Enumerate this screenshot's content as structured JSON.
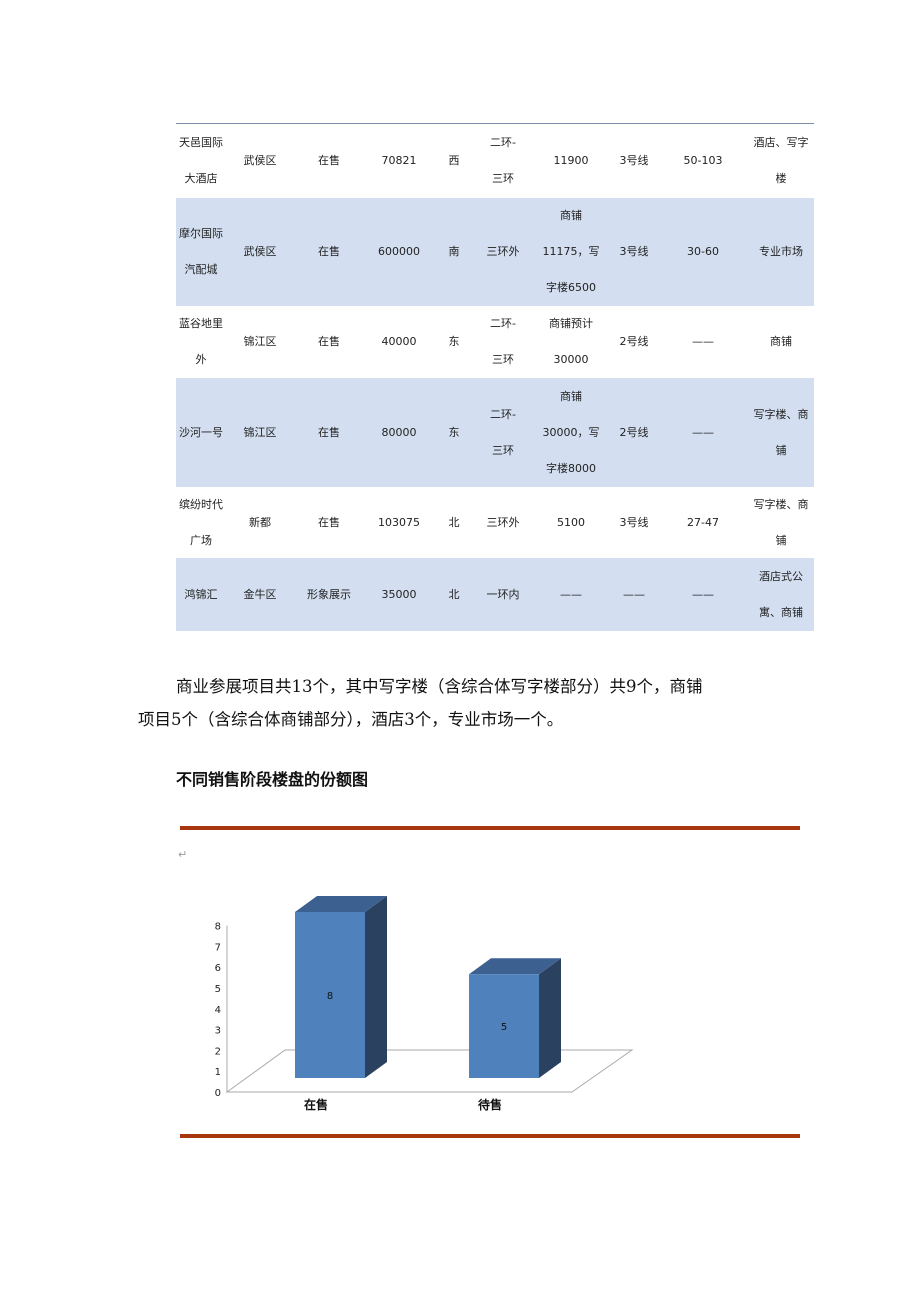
{
  "table": {
    "rows": [
      {
        "cells": [
          "天邑国际\n大酒店",
          "武侯区",
          "在售",
          "70821",
          "西",
          "二环-\n三环",
          "11900",
          "3号线",
          "50-103",
          "酒店、写字\n楼"
        ],
        "height": 74
      },
      {
        "cells": [
          "摩尔国际\n汽配城",
          "武侯区",
          "在售",
          "600000",
          "南",
          "三环外",
          "商铺\n11175，写\n字楼6500",
          "3号线",
          "30-60",
          "专业市场"
        ],
        "height": 108
      },
      {
        "cells": [
          "蓝谷地里\n外",
          "锦江区",
          "在售",
          "40000",
          "东",
          "二环-\n三环",
          "商铺预计\n30000",
          "2号线",
          "——",
          "商铺"
        ],
        "height": 72
      },
      {
        "cells": [
          "沙河一号",
          "锦江区",
          "在售",
          "80000",
          "东",
          "二环-\n三环",
          "商铺\n30000，写\n字楼8000",
          "2号线",
          "——",
          "写字楼、商\n铺"
        ],
        "height": 109
      },
      {
        "cells": [
          "缤纷时代\n广场",
          "新都",
          "在售",
          "103075",
          "北",
          "三环外",
          "5100",
          "3号线",
          "27-47",
          "写字楼、商\n铺"
        ],
        "height": 71
      },
      {
        "cells": [
          "鸿锦汇",
          "金牛区",
          "形象展示",
          "35000",
          "北",
          "一环内",
          "——",
          "——",
          "——",
          "酒店式公\n寓、商铺"
        ],
        "height": 73
      }
    ],
    "stripe_color": "#d3dff0"
  },
  "paragraph": {
    "line1": "商业参展项目共13个，其中写字楼（含综合体写字楼部分）共9个，商铺",
    "line2": "项目5个（含综合体商铺部分），酒店3个，专业市场一个。"
  },
  "section_heading": "不同销售阶段楼盘的份额图",
  "chart_data": {
    "type": "bar",
    "style": "3d-column",
    "categories": [
      "在售",
      "待售"
    ],
    "values": [
      8,
      5
    ],
    "data_labels": [
      "8",
      "5"
    ],
    "yticks": [
      "0",
      "1",
      "2",
      "3",
      "4",
      "5",
      "6",
      "7",
      "8"
    ],
    "ylim": [
      0,
      8
    ],
    "grid": false,
    "legend": "none",
    "bar_color": "#4f81bd",
    "bar_side_color": "#2a4260",
    "bar_top_color": "#3c6190",
    "rule_color": "#a8360f"
  }
}
